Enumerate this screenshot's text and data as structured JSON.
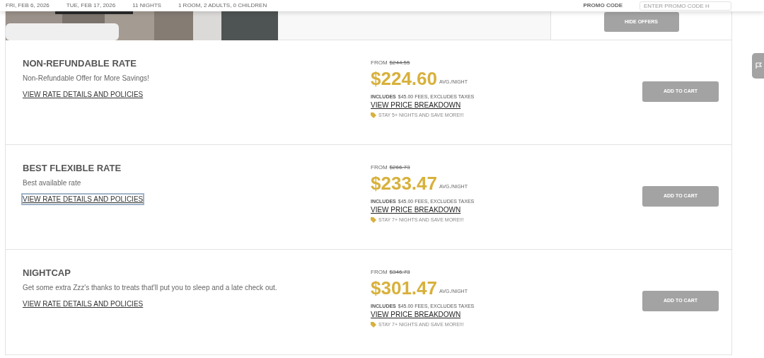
{
  "header": {
    "check_in": "FRI, FEB 6, 2026",
    "check_out": "TUE, FEB 17, 2026",
    "nights": "11 NIGHTS",
    "guests": "1 ROOM, 2 ADULTS, 0 CHILDREN",
    "promo_label": "PROMO CODE",
    "promo_placeholder": "ENTER PROMO CODE H"
  },
  "room": {
    "hide_button": "HIDE OFFERS"
  },
  "rates": [
    {
      "title": "NON-REFUNDABLE RATE",
      "description": "Non-Refundable Offer for More Savings!",
      "details_link": "VIEW RATE DETAILS AND POLICIES",
      "focused": false,
      "from": "FROM",
      "old_price": "$244.55",
      "price": "$224.60",
      "per": "AVG./NIGHT",
      "includes": "INCLUDES",
      "fees": "$45.00 FEES, EXCLUDES TAXES",
      "breakdown": "VIEW PRICE BREAKDOWN",
      "promo": "STAY 5+ NIGHTS AND SAVE MORE!!!",
      "button": "ADD TO CART"
    },
    {
      "title": "BEST FLEXIBLE RATE",
      "description": "Best available rate",
      "details_link": "VIEW RATE DETAILS AND POLICIES",
      "focused": true,
      "from": "FROM",
      "old_price": "$266.73",
      "price": "$233.47",
      "per": "AVG./NIGHT",
      "includes": "INCLUDES",
      "fees": "$45.00 FEES, EXCLUDES TAXES",
      "breakdown": "VIEW PRICE BREAKDOWN",
      "promo": "STAY 7+ NIGHTS AND SAVE MORE!!!",
      "button": "ADD TO CART"
    },
    {
      "title": "NIGHTCAP",
      "description": "Get some extra Zzz's thanks to treats that'll put you to sleep and a late check out.",
      "details_link": "VIEW RATE DETAILS AND POLICIES",
      "focused": false,
      "from": "FROM",
      "old_price": "$346.73",
      "price": "$301.47",
      "per": "AVG./NIGHT",
      "includes": "INCLUDES",
      "fees": "$45.00 FEES, EXCLUDES TAXES",
      "breakdown": "VIEW PRICE BREAKDOWN",
      "promo": "STAY 7+ NIGHTS AND SAVE MORE!!!",
      "button": "ADD TO CART"
    }
  ]
}
